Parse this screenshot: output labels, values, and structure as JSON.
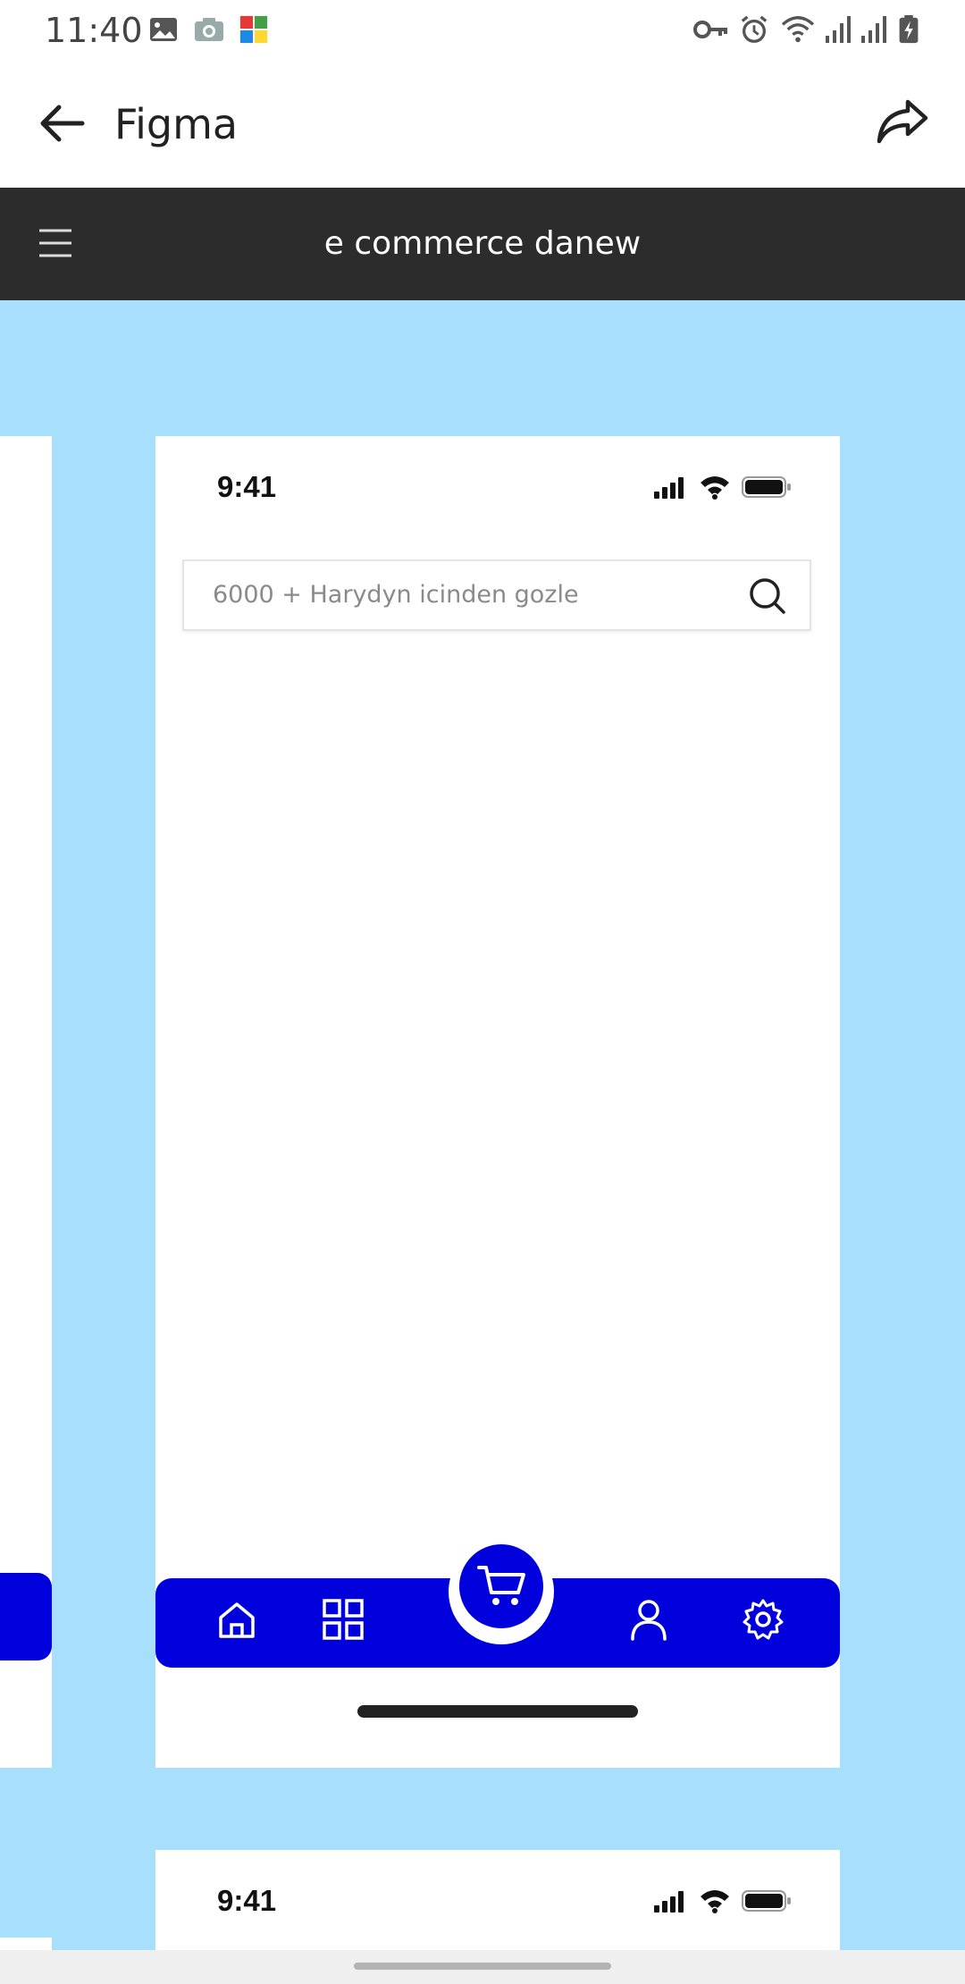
{
  "system": {
    "time": "11:40",
    "notification_icons": [
      "image-icon",
      "camera-icon",
      "puzzle-app-icon"
    ],
    "status_icons": [
      "vpn-key-icon",
      "alarm-icon",
      "wifi-icon",
      "signal-icon",
      "signal-icon",
      "battery-charging-icon"
    ]
  },
  "appbar": {
    "title": "Figma",
    "back_icon": "back-arrow-icon",
    "share_icon": "share-icon"
  },
  "figma_toolbar": {
    "menu_icon": "hamburger-menu-icon",
    "file_name": "e commerce danew"
  },
  "frames": {
    "main": {
      "time": "9:41",
      "search": {
        "placeholder": "6000 + Harydyn icinden gozle"
      },
      "nav_items": [
        "home-icon",
        "grid-icon",
        "cart-icon",
        "user-icon",
        "settings-icon"
      ]
    },
    "next": {
      "time": "9:41"
    }
  },
  "colors": {
    "canvas": "#a8dffd",
    "nav_blue": "#0000dd",
    "figma_bar": "#2c2c2c"
  }
}
